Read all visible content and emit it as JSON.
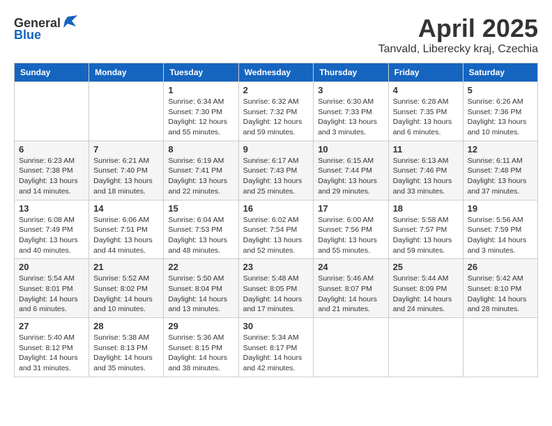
{
  "header": {
    "logo_general": "General",
    "logo_blue": "Blue",
    "title": "April 2025",
    "subtitle": "Tanvald, Liberecky kraj, Czechia"
  },
  "days_of_week": [
    "Sunday",
    "Monday",
    "Tuesday",
    "Wednesday",
    "Thursday",
    "Friday",
    "Saturday"
  ],
  "weeks": [
    [
      {
        "day": "",
        "info": ""
      },
      {
        "day": "",
        "info": ""
      },
      {
        "day": "1",
        "info": "Sunrise: 6:34 AM\nSunset: 7:30 PM\nDaylight: 12 hours\nand 55 minutes."
      },
      {
        "day": "2",
        "info": "Sunrise: 6:32 AM\nSunset: 7:32 PM\nDaylight: 12 hours\nand 59 minutes."
      },
      {
        "day": "3",
        "info": "Sunrise: 6:30 AM\nSunset: 7:33 PM\nDaylight: 13 hours\nand 3 minutes."
      },
      {
        "day": "4",
        "info": "Sunrise: 6:28 AM\nSunset: 7:35 PM\nDaylight: 13 hours\nand 6 minutes."
      },
      {
        "day": "5",
        "info": "Sunrise: 6:26 AM\nSunset: 7:36 PM\nDaylight: 13 hours\nand 10 minutes."
      }
    ],
    [
      {
        "day": "6",
        "info": "Sunrise: 6:23 AM\nSunset: 7:38 PM\nDaylight: 13 hours\nand 14 minutes."
      },
      {
        "day": "7",
        "info": "Sunrise: 6:21 AM\nSunset: 7:40 PM\nDaylight: 13 hours\nand 18 minutes."
      },
      {
        "day": "8",
        "info": "Sunrise: 6:19 AM\nSunset: 7:41 PM\nDaylight: 13 hours\nand 22 minutes."
      },
      {
        "day": "9",
        "info": "Sunrise: 6:17 AM\nSunset: 7:43 PM\nDaylight: 13 hours\nand 25 minutes."
      },
      {
        "day": "10",
        "info": "Sunrise: 6:15 AM\nSunset: 7:44 PM\nDaylight: 13 hours\nand 29 minutes."
      },
      {
        "day": "11",
        "info": "Sunrise: 6:13 AM\nSunset: 7:46 PM\nDaylight: 13 hours\nand 33 minutes."
      },
      {
        "day": "12",
        "info": "Sunrise: 6:11 AM\nSunset: 7:48 PM\nDaylight: 13 hours\nand 37 minutes."
      }
    ],
    [
      {
        "day": "13",
        "info": "Sunrise: 6:08 AM\nSunset: 7:49 PM\nDaylight: 13 hours\nand 40 minutes."
      },
      {
        "day": "14",
        "info": "Sunrise: 6:06 AM\nSunset: 7:51 PM\nDaylight: 13 hours\nand 44 minutes."
      },
      {
        "day": "15",
        "info": "Sunrise: 6:04 AM\nSunset: 7:53 PM\nDaylight: 13 hours\nand 48 minutes."
      },
      {
        "day": "16",
        "info": "Sunrise: 6:02 AM\nSunset: 7:54 PM\nDaylight: 13 hours\nand 52 minutes."
      },
      {
        "day": "17",
        "info": "Sunrise: 6:00 AM\nSunset: 7:56 PM\nDaylight: 13 hours\nand 55 minutes."
      },
      {
        "day": "18",
        "info": "Sunrise: 5:58 AM\nSunset: 7:57 PM\nDaylight: 13 hours\nand 59 minutes."
      },
      {
        "day": "19",
        "info": "Sunrise: 5:56 AM\nSunset: 7:59 PM\nDaylight: 14 hours\nand 3 minutes."
      }
    ],
    [
      {
        "day": "20",
        "info": "Sunrise: 5:54 AM\nSunset: 8:01 PM\nDaylight: 14 hours\nand 6 minutes."
      },
      {
        "day": "21",
        "info": "Sunrise: 5:52 AM\nSunset: 8:02 PM\nDaylight: 14 hours\nand 10 minutes."
      },
      {
        "day": "22",
        "info": "Sunrise: 5:50 AM\nSunset: 8:04 PM\nDaylight: 14 hours\nand 13 minutes."
      },
      {
        "day": "23",
        "info": "Sunrise: 5:48 AM\nSunset: 8:05 PM\nDaylight: 14 hours\nand 17 minutes."
      },
      {
        "day": "24",
        "info": "Sunrise: 5:46 AM\nSunset: 8:07 PM\nDaylight: 14 hours\nand 21 minutes."
      },
      {
        "day": "25",
        "info": "Sunrise: 5:44 AM\nSunset: 8:09 PM\nDaylight: 14 hours\nand 24 minutes."
      },
      {
        "day": "26",
        "info": "Sunrise: 5:42 AM\nSunset: 8:10 PM\nDaylight: 14 hours\nand 28 minutes."
      }
    ],
    [
      {
        "day": "27",
        "info": "Sunrise: 5:40 AM\nSunset: 8:12 PM\nDaylight: 14 hours\nand 31 minutes."
      },
      {
        "day": "28",
        "info": "Sunrise: 5:38 AM\nSunset: 8:13 PM\nDaylight: 14 hours\nand 35 minutes."
      },
      {
        "day": "29",
        "info": "Sunrise: 5:36 AM\nSunset: 8:15 PM\nDaylight: 14 hours\nand 38 minutes."
      },
      {
        "day": "30",
        "info": "Sunrise: 5:34 AM\nSunset: 8:17 PM\nDaylight: 14 hours\nand 42 minutes."
      },
      {
        "day": "",
        "info": ""
      },
      {
        "day": "",
        "info": ""
      },
      {
        "day": "",
        "info": ""
      }
    ]
  ]
}
